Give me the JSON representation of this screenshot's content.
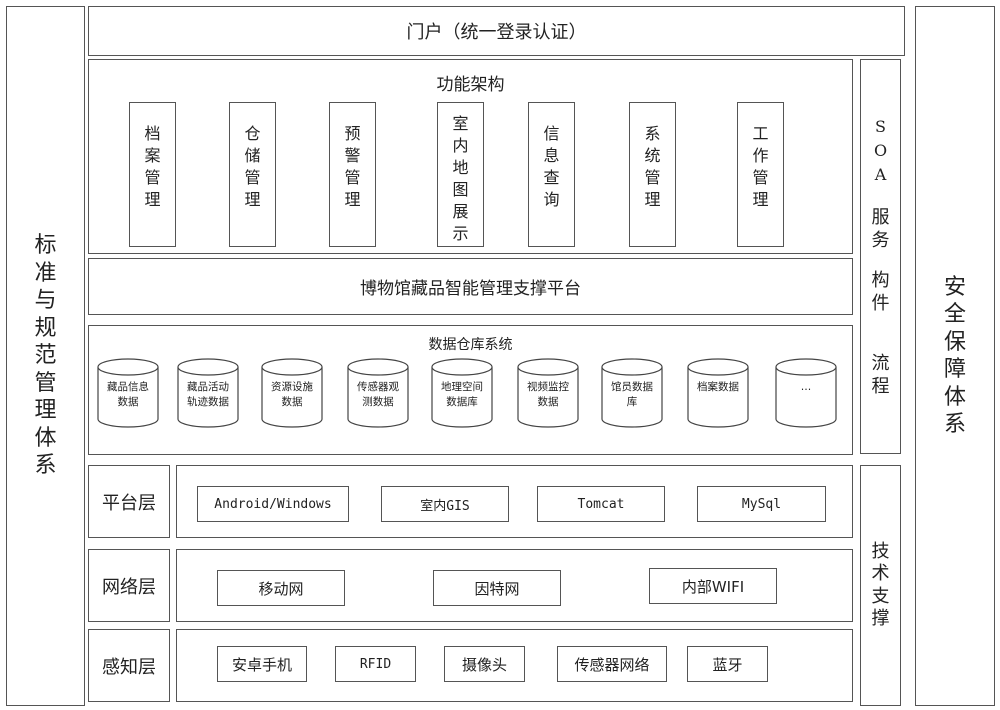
{
  "left_panel": {
    "label": [
      "标",
      "准",
      "与",
      "规",
      "范",
      "管",
      "理",
      "体",
      "系"
    ]
  },
  "right_panel": {
    "label": [
      "安",
      "全",
      "保",
      "障",
      "体",
      "系"
    ]
  },
  "portal": {
    "label": "门户（统一登录认证）"
  },
  "function_architecture": {
    "title": "功能架构",
    "items": [
      {
        "label": [
          "档",
          "案",
          "管",
          "理"
        ]
      },
      {
        "label": [
          "仓",
          "储",
          "管",
          "理"
        ]
      },
      {
        "label": [
          "预",
          "警",
          "管",
          "理"
        ]
      },
      {
        "label": [
          "室",
          "内",
          "地",
          "图",
          "展",
          "示"
        ]
      },
      {
        "label": [
          "信",
          "息",
          "查",
          "询"
        ]
      },
      {
        "label": [
          "系",
          "统",
          "管",
          "理"
        ]
      },
      {
        "label": [
          "工",
          "作",
          "管",
          "理"
        ]
      }
    ]
  },
  "support_platform": {
    "label": "博物馆藏品智能管理支撑平台"
  },
  "data_warehouse": {
    "title": "数据仓库系统",
    "databases": [
      {
        "line1": "藏品信息",
        "line2": "数据"
      },
      {
        "line1": "藏品活动",
        "line2": "轨迹数据"
      },
      {
        "line1": "资源设施",
        "line2": "数据"
      },
      {
        "line1": "传感器观",
        "line2": "测数据"
      },
      {
        "line1": "地理空间",
        "line2": "数据库"
      },
      {
        "line1": "视频监控",
        "line2": "数据"
      },
      {
        "line1": "馆员数据",
        "line2": "库"
      },
      {
        "line1": "档案数据",
        "line2": ""
      },
      {
        "line1": "…",
        "line2": ""
      }
    ]
  },
  "soa_column": {
    "groups": [
      [
        "S",
        "O",
        "A"
      ],
      [
        "服",
        "务"
      ],
      [
        "构",
        "件"
      ],
      [
        "流",
        "程"
      ]
    ]
  },
  "tech_support": {
    "label": [
      "技",
      "术",
      "支",
      "撑"
    ]
  },
  "layers": [
    {
      "label": "平台层",
      "items": [
        "Android/Windows",
        "室内GIS",
        "Tomcat",
        "MySql"
      ]
    },
    {
      "label": "网络层",
      "items": [
        "移动网",
        "因特网",
        "内部WIFI"
      ]
    },
    {
      "label": "感知层",
      "items": [
        "安卓手机",
        "RFID",
        "摄像头",
        "传感器网络",
        "蓝牙"
      ]
    }
  ]
}
